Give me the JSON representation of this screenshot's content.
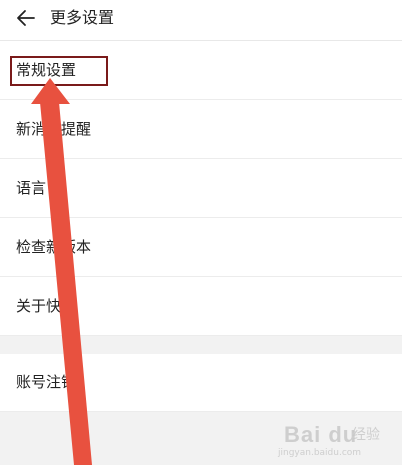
{
  "header": {
    "title": "更多设置",
    "back_icon": "arrow-left-icon"
  },
  "menu": {
    "items": [
      {
        "label": "常规设置"
      },
      {
        "label": "新消息提醒"
      },
      {
        "label": "语言"
      },
      {
        "label": "检查新版本"
      },
      {
        "label": "关于快手"
      },
      {
        "label": "账号注销"
      }
    ]
  },
  "annotation": {
    "highlight_color": "#7a1a1a",
    "arrow_color": "#e8513f"
  },
  "watermark": {
    "brand": "Bai du",
    "sub": "经验",
    "url": "jingyan.baidu.com"
  }
}
